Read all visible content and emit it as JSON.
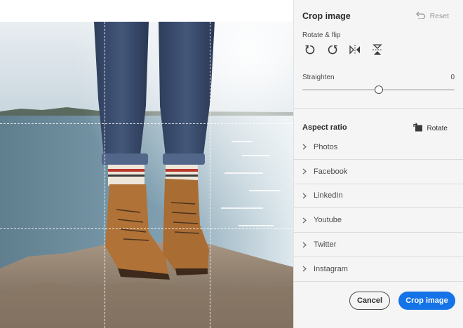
{
  "panel": {
    "title": "Crop image",
    "reset_label": "Reset",
    "rotate_flip_label": "Rotate & flip",
    "tools": [
      "rotate-left-icon",
      "rotate-right-icon",
      "flip-horizontal-icon",
      "flip-vertical-icon"
    ],
    "straighten_label": "Straighten",
    "straighten_value": "0",
    "straighten_fraction": 0.5,
    "aspect_ratio_label": "Aspect ratio",
    "rotate_label": "Rotate",
    "aspect_items": [
      "Photos",
      "Facebook",
      "LinkedIn",
      "Youtube",
      "Twitter",
      "Instagram"
    ],
    "cancel_label": "Cancel",
    "crop_label": "Crop image"
  },
  "colors": {
    "accent": "#1473e6",
    "panel_bg": "#f5f5f5",
    "text": "#2c2c2c",
    "muted": "#9a9a9a"
  }
}
